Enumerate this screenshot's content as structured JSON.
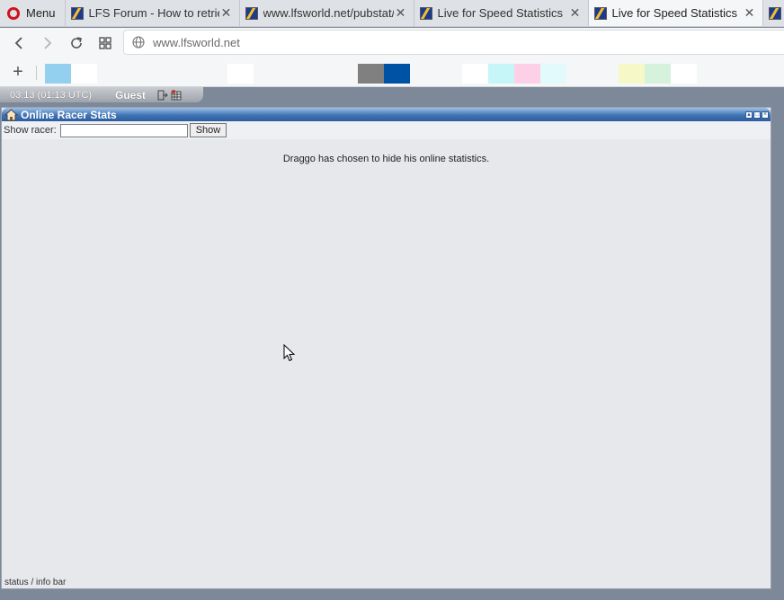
{
  "browser": {
    "menu_label": "Menu",
    "tabs": [
      {
        "title": "LFS Forum - How to retrie",
        "active": false
      },
      {
        "title": "www.lfsworld.net/pubstat/",
        "active": false
      },
      {
        "title": "Live for Speed Statistics",
        "active": false
      },
      {
        "title": "Live for Speed Statistics",
        "active": true
      }
    ],
    "close_glyph": "✕",
    "url": "www.lfsworld.net"
  },
  "bookmark_swatches": [
    {
      "color": "#93d0ef"
    },
    {
      "color": "#ffffff"
    },
    {
      "color": "#ffffff"
    },
    {
      "color": "#808080"
    },
    {
      "color": "#0052a5"
    },
    {
      "color": "#ffffff"
    },
    {
      "color": "#c7f6f8"
    },
    {
      "color": "#fdd0e7"
    },
    {
      "color": "#e2fafb"
    },
    {
      "color": "#f6f8c7"
    },
    {
      "color": "#d6f2dc"
    },
    {
      "color": "#ffffff"
    }
  ],
  "site": {
    "time": "03:13 (01:13 UTC)",
    "user": "Guest",
    "panel_title": "Online Racer Stats",
    "search_label": "Show racer:",
    "search_value": "",
    "show_button": "Show",
    "message": "Draggo has chosen to hide his online statistics.",
    "status_bar": "status / info bar"
  },
  "colors": {
    "page_background": "#7d8898",
    "panel_background": "#e6e8ec",
    "title_bar": "#3f74b5",
    "opera_red": "#d1121c"
  }
}
